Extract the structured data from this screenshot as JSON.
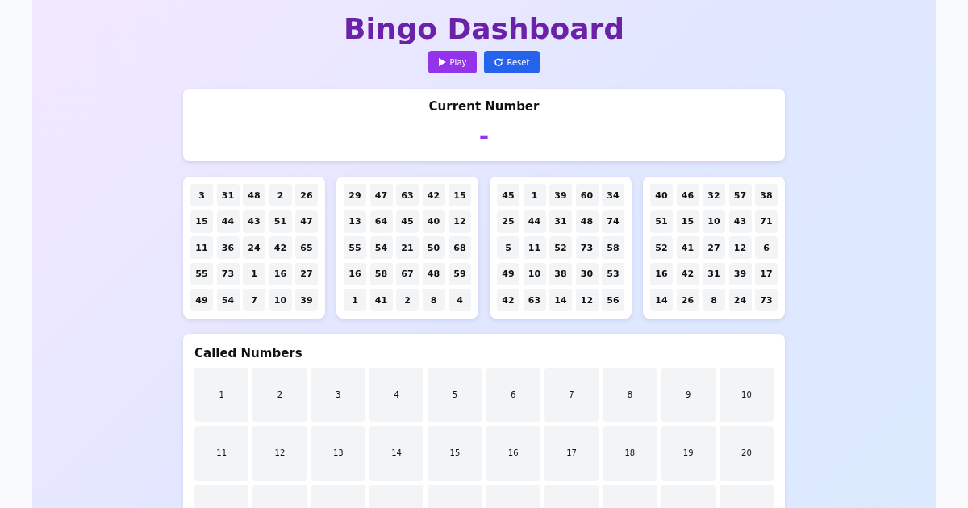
{
  "title": "Bingo Dashboard",
  "buttons": [
    {
      "kind": "play",
      "label": "Play"
    },
    {
      "kind": "reset",
      "label": "Reset"
    }
  ],
  "current_number": {
    "heading": "Current Number",
    "value": "-"
  },
  "bingo_cards": [
    {
      "rows": [
        [
          "3",
          "31",
          "48",
          "2",
          "26"
        ],
        [
          "15",
          "44",
          "43",
          "51",
          "47"
        ],
        [
          "11",
          "36",
          "24",
          "42",
          "65"
        ],
        [
          "55",
          "73",
          "1",
          "16",
          "27"
        ],
        [
          "49",
          "54",
          "7",
          "10",
          "39"
        ]
      ]
    },
    {
      "rows": [
        [
          "29",
          "47",
          "63",
          "42",
          "15"
        ],
        [
          "13",
          "64",
          "45",
          "40",
          "12"
        ],
        [
          "55",
          "54",
          "21",
          "50",
          "68"
        ],
        [
          "16",
          "58",
          "67",
          "48",
          "59"
        ],
        [
          "1",
          "41",
          "2",
          "8",
          "4"
        ]
      ]
    },
    {
      "rows": [
        [
          "45",
          "1",
          "39",
          "60",
          "34"
        ],
        [
          "25",
          "44",
          "31",
          "48",
          "74"
        ],
        [
          "5",
          "11",
          "52",
          "73",
          "58"
        ],
        [
          "49",
          "10",
          "38",
          "30",
          "53"
        ],
        [
          "42",
          "63",
          "14",
          "12",
          "56"
        ]
      ]
    },
    {
      "rows": [
        [
          "40",
          "46",
          "32",
          "57",
          "38"
        ],
        [
          "51",
          "15",
          "10",
          "43",
          "71"
        ],
        [
          "52",
          "41",
          "27",
          "12",
          "6"
        ],
        [
          "16",
          "42",
          "31",
          "39",
          "17"
        ],
        [
          "14",
          "26",
          "8",
          "24",
          "73"
        ]
      ]
    }
  ],
  "called_numbers": {
    "heading": "Called Numbers",
    "cells": [
      {
        "kind": "number",
        "number": "1"
      },
      {
        "kind": "number",
        "number": "2"
      },
      {
        "kind": "number",
        "number": "3"
      },
      {
        "kind": "number",
        "number": "4"
      },
      {
        "kind": "number",
        "number": "5"
      },
      {
        "kind": "number",
        "number": "6"
      },
      {
        "kind": "number",
        "number": "7"
      },
      {
        "kind": "number",
        "number": "8"
      },
      {
        "kind": "number",
        "number": "9"
      },
      {
        "kind": "number",
        "number": "10"
      },
      {
        "kind": "number",
        "number": "11"
      },
      {
        "kind": "number",
        "number": "12"
      },
      {
        "kind": "number",
        "number": "13"
      },
      {
        "kind": "number",
        "number": "14"
      },
      {
        "kind": "number",
        "number": "15"
      },
      {
        "kind": "number",
        "number": "16"
      },
      {
        "kind": "number",
        "number": "17"
      },
      {
        "kind": "number",
        "number": "18"
      },
      {
        "kind": "number",
        "number": "19"
      },
      {
        "kind": "number",
        "number": "20"
      },
      {
        "kind": "cut_off"
      },
      {
        "kind": "cut_off"
      },
      {
        "kind": "cut_off"
      },
      {
        "kind": "cut_off"
      },
      {
        "kind": "cut_off"
      },
      {
        "kind": "cut_off"
      },
      {
        "kind": "cut_off"
      },
      {
        "kind": "cut_off"
      },
      {
        "kind": "cut_off"
      },
      {
        "kind": "cut_off"
      }
    ]
  }
}
